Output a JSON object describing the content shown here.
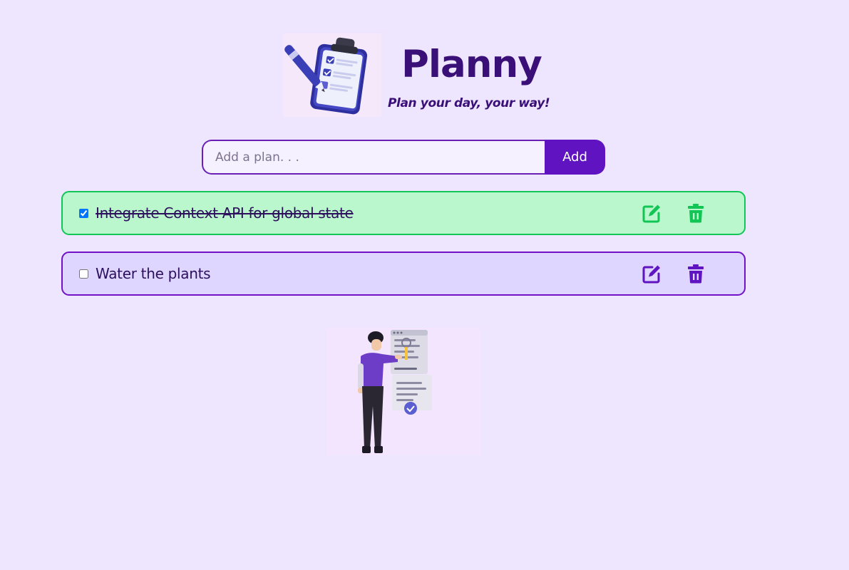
{
  "header": {
    "title": "Planny",
    "tagline": "Plan your day, your way!",
    "logo_icon": "clipboard-checklist-icon"
  },
  "add_form": {
    "placeholder": "Add a plan. . .",
    "value": "",
    "button_label": "Add"
  },
  "plans": [
    {
      "text": "Integrate Context API for global state",
      "completed": true
    },
    {
      "text": "Water the plants",
      "completed": false
    }
  ],
  "icons": {
    "edit": "edit-icon",
    "delete": "trash-icon"
  },
  "colors": {
    "background": "#ede6fe",
    "accent": "#6013c0",
    "completed_bg": "#baf7cd",
    "completed_border": "#12c655",
    "pending_bg": "#ded6fe",
    "pending_border": "#7212c8"
  },
  "illustration_icon": "person-reviewing-document-illustration"
}
